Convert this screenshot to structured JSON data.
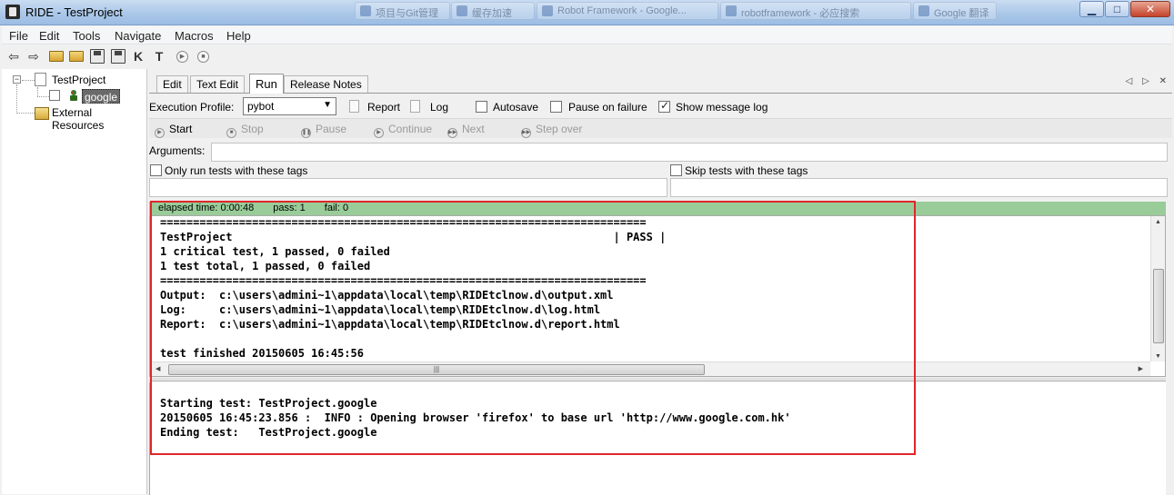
{
  "window": {
    "title": "RIDE - TestProject",
    "background_tabs": [
      "项目与Git管理",
      "缓存加速",
      "Robot Framework - Google...",
      "robotframework - 必应搜索",
      "Google 翻译"
    ]
  },
  "menu": [
    "File",
    "Edit",
    "Tools",
    "Navigate",
    "Macros",
    "Help"
  ],
  "toolbar": {
    "k_label": "K",
    "t_label": "T"
  },
  "tree": {
    "root": "TestProject",
    "child": "google",
    "resources": "External Resources"
  },
  "tabs": [
    "Edit",
    "Text Edit",
    "Run",
    "Release Notes"
  ],
  "active_tab": "Run",
  "run": {
    "profile_label": "Execution Profile:",
    "profile_value": "pybot",
    "report": "Report",
    "log": "Log",
    "autosave": "Autosave",
    "pause_on_failure": "Pause on failure",
    "show_message_log": "Show message log",
    "show_message_log_checked": true,
    "buttons": [
      "Start",
      "Stop",
      "Pause",
      "Continue",
      "Next",
      "Step over"
    ],
    "arguments_label": "Arguments:",
    "include_tags_label": "Only run tests with these tags",
    "exclude_tags_label": "Skip tests with these tags"
  },
  "status": {
    "elapsed": "elapsed time: 0:00:48",
    "pass": "pass: 1",
    "fail": "fail: 0",
    "color": "#99cc99"
  },
  "console_lines": [
    "==========================================================================",
    "TestProject                                                          | PASS |",
    "1 critical test, 1 passed, 0 failed",
    "1 test total, 1 passed, 0 failed",
    "==========================================================================",
    "Output:  c:\\users\\admini~1\\appdata\\local\\temp\\RIDEtclnow.d\\output.xml",
    "Log:     c:\\users\\admini~1\\appdata\\local\\temp\\RIDEtclnow.d\\log.html",
    "Report:  c:\\users\\admini~1\\appdata\\local\\temp\\RIDEtclnow.d\\report.html",
    "",
    "test finished 20150605 16:45:56"
  ],
  "message_log_lines": [
    "Starting test: TestProject.google",
    "20150605 16:45:23.856 :  INFO : Opening browser 'firefox' to base url 'http://www.google.com.hk'",
    "Ending test:   TestProject.google"
  ],
  "highlight_color": "#e0262a"
}
